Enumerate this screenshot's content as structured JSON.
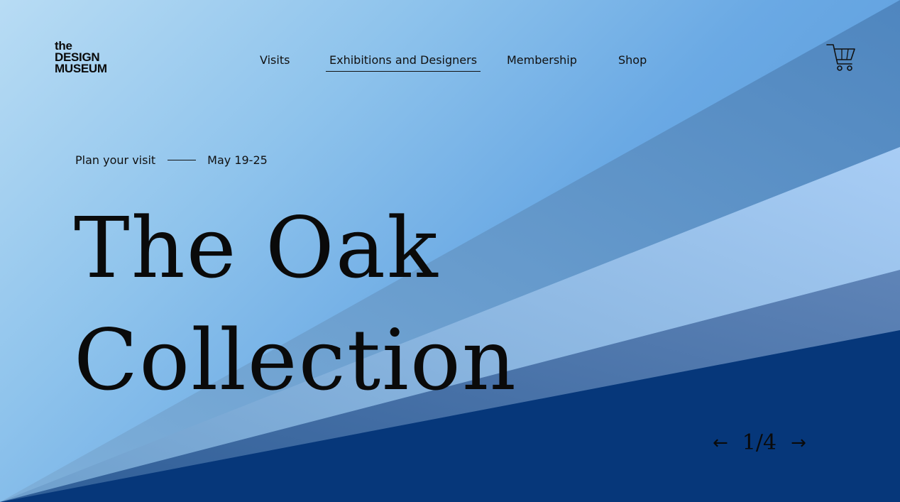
{
  "logo": {
    "line1": "the",
    "line2": "DESIGN",
    "line3": "MUSEUM"
  },
  "nav": {
    "items": [
      {
        "label": "Visits"
      },
      {
        "label": "Exhibitions and Designers",
        "active": true
      },
      {
        "label": "Membership"
      },
      {
        "label": "Shop"
      }
    ]
  },
  "cart": {
    "icon": "cart-icon"
  },
  "hero": {
    "plan_label": "Plan your visit",
    "date": "May 19-25",
    "title_line1": "The Oak",
    "title_line2": "Collection"
  },
  "pager": {
    "prev": "←",
    "current": "1/4",
    "next": "→"
  },
  "colors": {
    "sky_light": "#b8dcf4",
    "sky_mid": "#6aa9e4",
    "navy": "#06377a",
    "text": "#0a0a0a"
  }
}
